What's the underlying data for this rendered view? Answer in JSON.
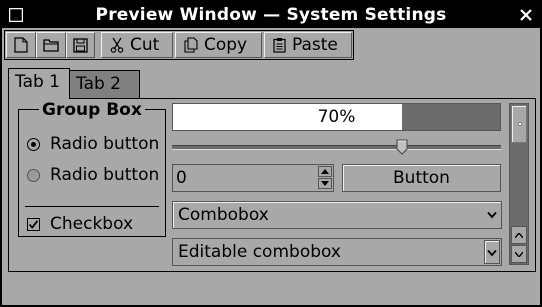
{
  "window": {
    "title": "Preview Window — System Settings"
  },
  "toolbar": {
    "cut_label": "Cut",
    "copy_label": "Copy",
    "paste_label": "Paste",
    "icons": [
      "new-document-icon",
      "open-folder-icon",
      "save-icon",
      "scissors-icon",
      "copy-icon",
      "clipboard-icon"
    ]
  },
  "tabs": [
    {
      "label": "Tab 1",
      "active": true
    },
    {
      "label": "Tab 2",
      "active": false
    }
  ],
  "groupbox": {
    "title": "Group Box",
    "radios": [
      {
        "label": "Radio button",
        "checked": true,
        "enabled": true
      },
      {
        "label": "Radio button",
        "checked": false,
        "enabled": false
      }
    ],
    "checkbox": {
      "label": "Checkbox",
      "checked": true
    }
  },
  "progress": {
    "value": 70,
    "text": "70%"
  },
  "slider": {
    "value": 0.7
  },
  "spinbox": {
    "value": "0"
  },
  "button": {
    "label": "Button"
  },
  "combobox": {
    "selected": "Combobox"
  },
  "editable_combobox": {
    "value": "Editable combobox"
  },
  "colors": {
    "window_bg": "#a8a8a8",
    "titlebar_bg": "#000000",
    "titlebar_text": "#ffffff",
    "inactive_tab_bg": "#808080",
    "progress_fill": "#ffffff",
    "progress_track": "#6b6b6b"
  }
}
